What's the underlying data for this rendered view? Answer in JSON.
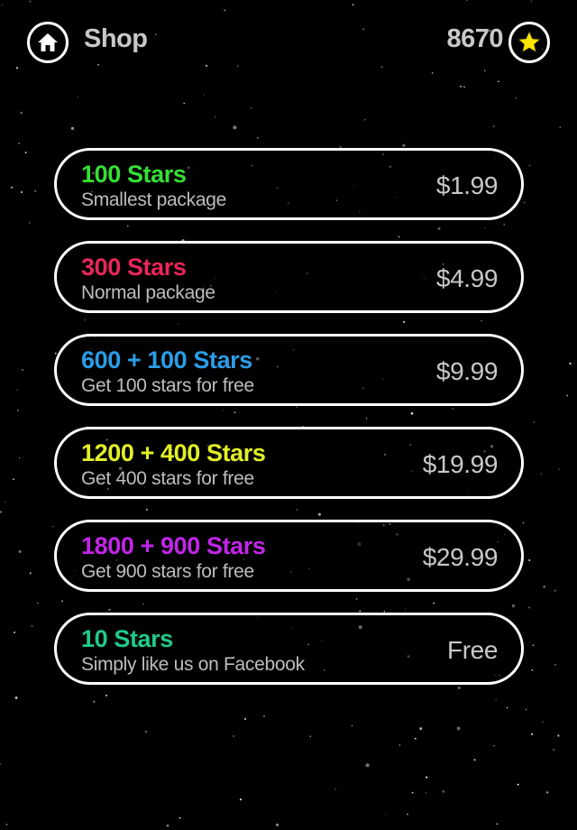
{
  "header": {
    "title": "Shop",
    "star_count": "8670"
  },
  "colors": {
    "background": "#000000",
    "border": "#ffffff",
    "text_muted": "#c8c8c8",
    "star_gold": "#ffe600"
  },
  "packages": [
    {
      "name": "100 Stars",
      "description": "Smallest package",
      "price": "$1.99",
      "color": "#35e035"
    },
    {
      "name": "300 Stars",
      "description": "Normal package",
      "price": "$4.99",
      "color": "#e8265a"
    },
    {
      "name": "600 + 100 Stars",
      "description": "Get 100 stars for free",
      "price": "$9.99",
      "color": "#2b9de8"
    },
    {
      "name": "1200 + 400 Stars",
      "description": "Get 400 stars for free",
      "price": "$19.99",
      "color": "#e2f026"
    },
    {
      "name": "1800 + 900 Stars",
      "description": "Get 900 stars for free",
      "price": "$29.99",
      "color": "#c126e8"
    },
    {
      "name": "10 Stars",
      "description": "Simply like us on Facebook",
      "price": "Free",
      "color": "#20c98a"
    }
  ]
}
